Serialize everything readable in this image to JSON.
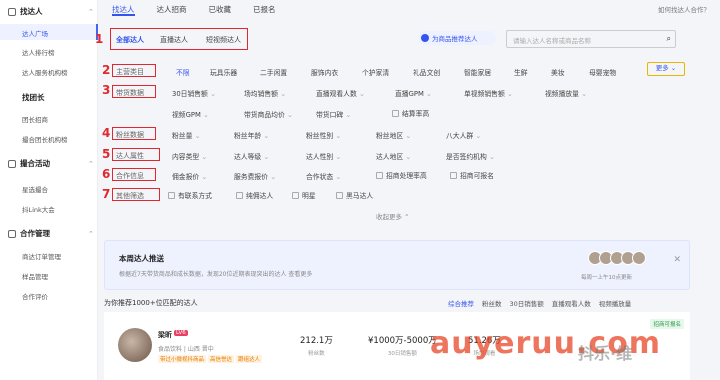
{
  "sidebar": {
    "groups": [
      {
        "label": "找达人",
        "items": [
          "达人广场",
          "达人排行榜",
          "达人服务机构榜"
        ]
      },
      {
        "label": "找团长",
        "items": [
          "团长招商",
          "撮合团长机构榜"
        ]
      },
      {
        "label": "撮合活动",
        "items": [
          "星选撮合",
          "抖Link大会"
        ]
      },
      {
        "label": "合作管理",
        "items": [
          "商达订单管理",
          "样品管理",
          "合作评价"
        ]
      }
    ]
  },
  "tabs": [
    "找达人",
    "达人招商",
    "已收藏",
    "已报名"
  ],
  "help": "如何找达人合作？",
  "mode_tabs": [
    "全部达人",
    "直播达人",
    "短视频达人"
  ],
  "recommend_pill": "为商品推荐达人",
  "search_placeholder": "请输入达人名称或商品名称",
  "annotations": [
    "1",
    "2",
    "3",
    "4",
    "5",
    "6",
    "7"
  ],
  "filter_labels": [
    "主营类目",
    "带货数据",
    "粉丝数据",
    "达人属性",
    "合作信息",
    "其他筛选"
  ],
  "categories": [
    "不限",
    "玩具乐器",
    "二手闲置",
    "服饰内衣",
    "个护家清",
    "礼品文创",
    "智能家居",
    "生鲜",
    "美妆",
    "母婴宠物"
  ],
  "more": "更多",
  "sales_row1": [
    "30日销售额",
    "场均销售额",
    "直播观看人数",
    "直播GPM",
    "单视频销售额",
    "视频播放量"
  ],
  "sales_row2": [
    "视频GPM",
    "带货商品均价",
    "带货口碑"
  ],
  "sales_check": "结算率高",
  "fans_filters": [
    "粉丝量",
    "粉丝年龄",
    "粉丝性别",
    "粉丝地区",
    "八大人群"
  ],
  "attr_filters": [
    "内容类型",
    "达人等级",
    "达人性别",
    "达人地区",
    "是否签约机构"
  ],
  "coop_filters": [
    "佣金报价",
    "服务费报价",
    "合作状态"
  ],
  "coop_checks": [
    "招商处理率高",
    "招商可报名"
  ],
  "other_checks": [
    "有联系方式",
    "纯佣达人",
    "明星",
    "黑马达人"
  ],
  "collapse": "收起更多",
  "promo": {
    "title": "本周达人推送",
    "subtitle": "根据近7天带货商品和成长数据，发现20位近期表现突出的达人 查看更多",
    "caption": "每周一上午10点更新"
  },
  "result_header": "为你推荐1000+位匹配的达人",
  "sorts": [
    "综合推荐",
    "粉丝数",
    "30日销售额",
    "直播观看人数",
    "视频播放量"
  ],
  "creator": {
    "name": "梁昕",
    "level": "LV6",
    "category": "食品饮料 | 山西 晋中",
    "tags": [
      "带过小微视抖商品",
      "高信誉达",
      "跟组达人"
    ],
    "fans": "212.1万",
    "fans_label": "粉丝数",
    "sales": "¥1000万-5000万",
    "sales_label": "30日销售额",
    "viewers": "51.26万",
    "viewers_label": "场均观看",
    "badge": "招商可报名"
  },
  "watermark": "auyeruu.com",
  "watermark2": "抖乐·维"
}
